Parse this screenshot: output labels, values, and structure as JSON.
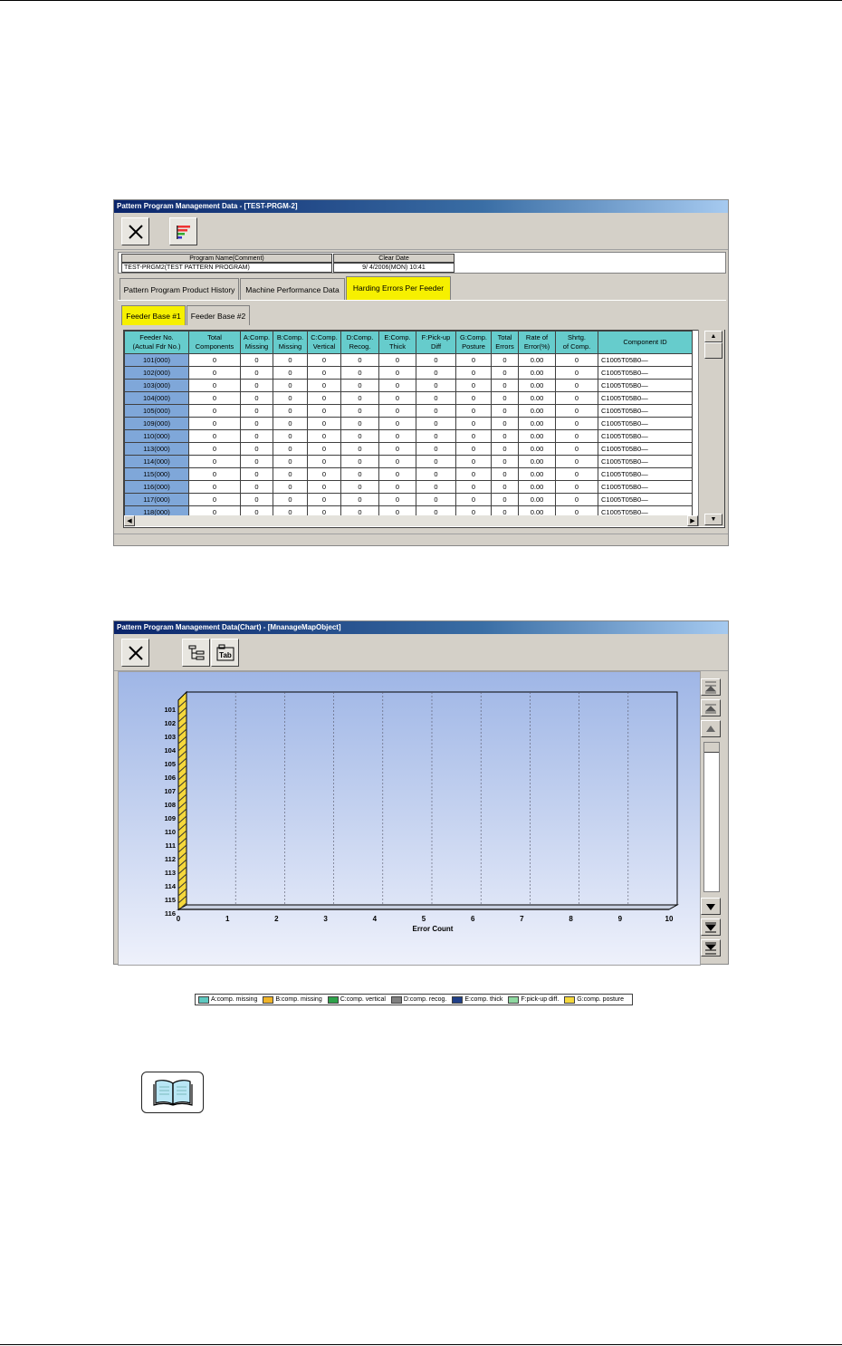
{
  "window1": {
    "title": "Pattern Program Management Data - [TEST-PRGM-2]",
    "close_icon": "close-x-icon",
    "chart_icon": "color-bars-icon",
    "info": {
      "program_header": "Program Name(Comment)",
      "date_header": "Clear Date",
      "program_value": "TEST-PRGM2(TEST PATTERN PROGRAM)",
      "date_value": "9/ 4/2006(MON) 10:41"
    },
    "tabs": [
      "Pattern Program Product History",
      "Machine Performance Data",
      "Harding Errors Per Feeder"
    ],
    "active_tab": 2,
    "subtabs": [
      "Feeder Base #1",
      "Feeder Base #2"
    ],
    "active_subtab": 0,
    "columns": [
      [
        "Feeder No.",
        "(Actual Fdr No.)"
      ],
      [
        "Total",
        "Components"
      ],
      [
        "A:Comp.",
        "Missing"
      ],
      [
        "B:Comp.",
        "Missing"
      ],
      [
        "C:Comp.",
        "Vertical"
      ],
      [
        "D:Comp.",
        "Recog."
      ],
      [
        "E:Comp.",
        "Thick"
      ],
      [
        "F:Pick-up",
        "Diff"
      ],
      [
        "G:Comp.",
        "Posture"
      ],
      [
        "Total",
        "Errors"
      ],
      [
        "Rate of",
        "Error(%)"
      ],
      [
        "Shrtg.",
        "of Comp."
      ],
      [
        "Component ID",
        ""
      ]
    ],
    "rows": [
      [
        "101(000)",
        "0",
        "0",
        "0",
        "0",
        "0",
        "0",
        "0",
        "0",
        "0",
        "0.00",
        "0",
        "C1005T05B0—"
      ],
      [
        "102(000)",
        "0",
        "0",
        "0",
        "0",
        "0",
        "0",
        "0",
        "0",
        "0",
        "0.00",
        "0",
        "C1005T05B0—"
      ],
      [
        "103(000)",
        "0",
        "0",
        "0",
        "0",
        "0",
        "0",
        "0",
        "0",
        "0",
        "0.00",
        "0",
        "C1005T05B0—"
      ],
      [
        "104(000)",
        "0",
        "0",
        "0",
        "0",
        "0",
        "0",
        "0",
        "0",
        "0",
        "0.00",
        "0",
        "C1005T05B0—"
      ],
      [
        "105(000)",
        "0",
        "0",
        "0",
        "0",
        "0",
        "0",
        "0",
        "0",
        "0",
        "0.00",
        "0",
        "C1005T05B0—"
      ],
      [
        "109(000)",
        "0",
        "0",
        "0",
        "0",
        "0",
        "0",
        "0",
        "0",
        "0",
        "0.00",
        "0",
        "C1005T05B0—"
      ],
      [
        "110(000)",
        "0",
        "0",
        "0",
        "0",
        "0",
        "0",
        "0",
        "0",
        "0",
        "0.00",
        "0",
        "C1005T05B0—"
      ],
      [
        "113(000)",
        "0",
        "0",
        "0",
        "0",
        "0",
        "0",
        "0",
        "0",
        "0",
        "0.00",
        "0",
        "C1005T05B0—"
      ],
      [
        "114(000)",
        "0",
        "0",
        "0",
        "0",
        "0",
        "0",
        "0",
        "0",
        "0",
        "0.00",
        "0",
        "C1005T05B0—"
      ],
      [
        "115(000)",
        "0",
        "0",
        "0",
        "0",
        "0",
        "0",
        "0",
        "0",
        "0",
        "0.00",
        "0",
        "C1005T05B0—"
      ],
      [
        "116(000)",
        "0",
        "0",
        "0",
        "0",
        "0",
        "0",
        "0",
        "0",
        "0",
        "0.00",
        "0",
        "C1005T05B0—"
      ],
      [
        "117(000)",
        "0",
        "0",
        "0",
        "0",
        "0",
        "0",
        "0",
        "0",
        "0",
        "0.00",
        "0",
        "C1005T05B0—"
      ],
      [
        "118(000)",
        "0",
        "0",
        "0",
        "0",
        "0",
        "0",
        "0",
        "0",
        "0",
        "0.00",
        "0",
        "C1005T05B0—"
      ]
    ]
  },
  "window2": {
    "title": "Pattern Program Management Data(Chart) - [MnanageMapObject]",
    "close_icon": "close-x-icon",
    "tree_icon": "tree-view-icon",
    "tab_icon": "tab-view-icon",
    "tab_icon_text": "Tab",
    "scroll_icons": [
      "scroll-top-icon",
      "scroll-page-up-icon",
      "scroll-up-icon",
      "scroll-down-icon",
      "scroll-page-down-icon",
      "scroll-bottom-icon"
    ]
  },
  "chart_data": {
    "type": "bar",
    "orientation": "horizontal",
    "stacked": true,
    "categories": [
      "101",
      "102",
      "103",
      "104",
      "105",
      "106",
      "107",
      "108",
      "109",
      "110",
      "111",
      "112",
      "113",
      "114",
      "115",
      "116"
    ],
    "series": [
      {
        "name": "A:comp. missing",
        "color": "#5ec8c0",
        "values": [
          0,
          0,
          0,
          0,
          0,
          0,
          0,
          0,
          0,
          0,
          0,
          0,
          0,
          0,
          0,
          0
        ]
      },
      {
        "name": "B:comp. missing",
        "color": "#f0b428",
        "values": [
          0,
          0,
          0,
          0,
          0,
          0,
          0,
          0,
          0,
          0,
          0,
          0,
          0,
          0,
          0,
          0
        ]
      },
      {
        "name": "C:comp. vertical",
        "color": "#2ea24a",
        "values": [
          0,
          0,
          0,
          0,
          0,
          0,
          0,
          0,
          0,
          0,
          0,
          0,
          0,
          0,
          0,
          0
        ]
      },
      {
        "name": "D:comp. recog.",
        "color": "#808080",
        "values": [
          0,
          0,
          0,
          0,
          0,
          0,
          0,
          0,
          0,
          0,
          0,
          0,
          0,
          0,
          0,
          0
        ]
      },
      {
        "name": "E:comp. thick",
        "color": "#1f3f88",
        "values": [
          0,
          0,
          0,
          0,
          0,
          0,
          0,
          0,
          0,
          0,
          0,
          0,
          0,
          0,
          0,
          0
        ]
      },
      {
        "name": "F:pick-up diff.",
        "color": "#8ed8a0",
        "values": [
          0,
          0,
          0,
          0,
          0,
          0,
          0,
          0,
          0,
          0,
          0,
          0,
          0,
          0,
          0,
          0
        ]
      },
      {
        "name": "G:comp. posture",
        "color": "#f5d83c",
        "values": [
          0,
          0,
          0,
          0,
          0,
          0,
          0,
          0,
          0,
          0,
          0,
          0,
          0,
          0,
          0,
          0
        ]
      }
    ],
    "x_ticks": [
      "0",
      "1",
      "2",
      "3",
      "4",
      "5",
      "6",
      "7",
      "8",
      "9",
      "10"
    ],
    "xlabel": "Error Count",
    "ylabel": "",
    "xlim": [
      0,
      10
    ],
    "grid": "vertical dashed",
    "legend_position": "bottom"
  },
  "book_icon": "manual-book-icon"
}
